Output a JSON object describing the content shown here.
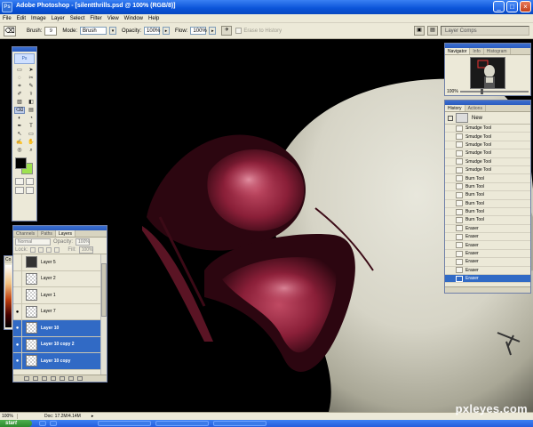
{
  "titlebar": {
    "title": "Adobe Photoshop - [silentthrills.psd @ 100% (RGB/8)]",
    "ps_icon": "Ps"
  },
  "window_buttons": {
    "minimize": "_",
    "maximize": "□",
    "close": "×"
  },
  "menu": [
    "File",
    "Edit",
    "Image",
    "Layer",
    "Select",
    "Filter",
    "View",
    "Window",
    "Help"
  ],
  "options": {
    "brush_label": "Brush:",
    "brush_size": "9",
    "mode_label": "Mode:",
    "mode_value": "Brush",
    "opacity_label": "Opacity:",
    "opacity_value": "100%",
    "flow_label": "Flow:",
    "flow_value": "100%",
    "sample_all_label": "Erase to History",
    "palette_well": "Layer Comps"
  },
  "toolbox": {
    "logo": "Ps",
    "tools": [
      "▭",
      "➤",
      "◌",
      "✂",
      "⌗",
      "✎",
      "✐",
      "⚕",
      "▧",
      "◧",
      "⌫",
      "▤",
      "◐",
      "◔",
      "✒",
      "T",
      "↖",
      "▭",
      "✍",
      "✋",
      "◎",
      "⌕"
    ],
    "fg_color": "#000000",
    "bg_color": "#9ee24f"
  },
  "navigator": {
    "tabs": [
      "Navigator",
      "Info",
      "Histogram"
    ],
    "zoom": "100%"
  },
  "history": {
    "tabs": [
      "History",
      "Actions"
    ],
    "snapshot_label": "New",
    "items": [
      {
        "label": "Smudge Tool",
        "active": false
      },
      {
        "label": "Smudge Tool",
        "active": false
      },
      {
        "label": "Smudge Tool",
        "active": false
      },
      {
        "label": "Smudge Tool",
        "active": false
      },
      {
        "label": "Smudge Tool",
        "active": false
      },
      {
        "label": "Smudge Tool",
        "active": false
      },
      {
        "label": "Burn Tool",
        "active": false
      },
      {
        "label": "Burn Tool",
        "active": false
      },
      {
        "label": "Burn Tool",
        "active": false
      },
      {
        "label": "Burn Tool",
        "active": false
      },
      {
        "label": "Burn Tool",
        "active": false
      },
      {
        "label": "Burn Tool",
        "active": false
      },
      {
        "label": "Eraser",
        "active": false
      },
      {
        "label": "Eraser",
        "active": false
      },
      {
        "label": "Eraser",
        "active": false
      },
      {
        "label": "Eraser",
        "active": false
      },
      {
        "label": "Eraser",
        "active": false
      },
      {
        "label": "Eraser",
        "active": false
      },
      {
        "label": "Eraser",
        "active": true
      }
    ]
  },
  "layers": {
    "tabs": [
      "Channels",
      "Paths",
      "Layers"
    ],
    "blend_mode": "Normal",
    "opacity_label": "Opacity:",
    "opacity_value": "100%",
    "lock_label": "Lock:",
    "fill_label": "Fill:",
    "fill_value": "100%",
    "items": [
      {
        "name": "Layer 5",
        "visible": false,
        "selected": false,
        "dark": true
      },
      {
        "name": "Layer 2",
        "visible": false,
        "selected": false,
        "dark": false
      },
      {
        "name": "Layer 1",
        "visible": false,
        "selected": false,
        "dark": false
      },
      {
        "name": "Layer 7",
        "visible": true,
        "selected": false,
        "dark": false
      },
      {
        "name": "Layer 10",
        "visible": true,
        "selected": true,
        "dark": false
      },
      {
        "name": "Layer 10 copy 2",
        "visible": true,
        "selected": true,
        "dark": false
      },
      {
        "name": "Layer 10 copy",
        "visible": true,
        "selected": true,
        "dark": false
      }
    ]
  },
  "colorpanel": {
    "label": "Co"
  },
  "statusbar": {
    "zoom": "100%",
    "doc": "Doc: 17.2M/4.14M"
  },
  "taskbar": {
    "start": "start"
  },
  "watermark": "pxleyes.com"
}
